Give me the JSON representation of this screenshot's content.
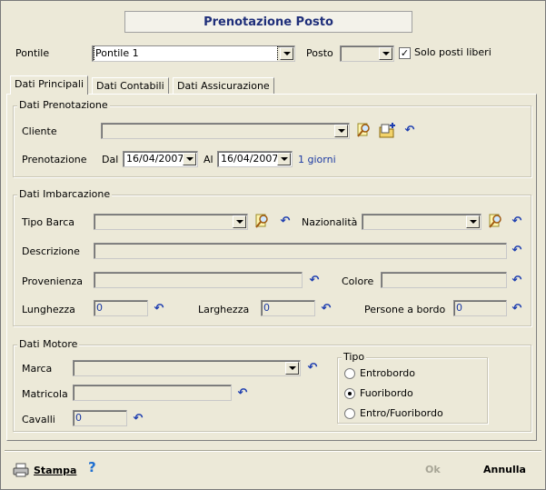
{
  "title": "Prenotazione Posto",
  "top": {
    "pontile_label": "Pontile",
    "pontile_value": "Pontile 1",
    "posto_label": "Posto",
    "posto_value": "",
    "solo_liberi_label": "Solo posti liberi",
    "solo_liberi_checked": true
  },
  "tabs": [
    {
      "label": "Dati Principali",
      "active": true
    },
    {
      "label": "Dati Contabili",
      "active": false
    },
    {
      "label": "Dati Assicurazione",
      "active": false
    }
  ],
  "prenotazione": {
    "group_title": "Dati Prenotazione",
    "cliente_label": "Cliente",
    "cliente_value": "",
    "prenotazione_label": "Prenotazione",
    "dal_label": "Dal",
    "dal_value": "16/04/2007",
    "al_label": "Al",
    "al_value": "16/04/2007",
    "giorni_text": "1 giorni"
  },
  "imbarcazione": {
    "group_title": "Dati Imbarcazione",
    "tipo_barca_label": "Tipo Barca",
    "tipo_barca_value": "",
    "nazionalita_label": "Nazionalità",
    "nazionalita_value": "",
    "descrizione_label": "Descrizione",
    "descrizione_value": "",
    "provenienza_label": "Provenienza",
    "provenienza_value": "",
    "colore_label": "Colore",
    "colore_value": "",
    "lunghezza_label": "Lunghezza",
    "lunghezza_value": "0",
    "larghezza_label": "Larghezza",
    "larghezza_value": "0",
    "persone_label": "Persone a bordo",
    "persone_value": "0"
  },
  "motore": {
    "group_title": "Dati Motore",
    "marca_label": "Marca",
    "marca_value": "",
    "matricola_label": "Matricola",
    "matricola_value": "",
    "cavalli_label": "Cavalli",
    "cavalli_value": "0",
    "tipo_group_title": "Tipo",
    "tipo_options": [
      "Entrobordo",
      "Fuoribordo",
      "Entro/Fuoribordo"
    ],
    "tipo_selected": "Fuoribordo"
  },
  "footer": {
    "stampa_label": "Stampa",
    "help_glyph": "?",
    "ok_label": "Ok",
    "annulla_label": "Annulla"
  },
  "icons": {
    "undo": "undo-arrow-icon",
    "search": "search-magnifier-icon",
    "new_record": "new-record-icon",
    "printer": "printer-icon",
    "help": "help-icon"
  },
  "colors": {
    "window_bg": "#ece9d8",
    "title_text": "#1f2f7a",
    "link_text": "#1c3aa3",
    "undo_icon": "#1f3fb0"
  }
}
